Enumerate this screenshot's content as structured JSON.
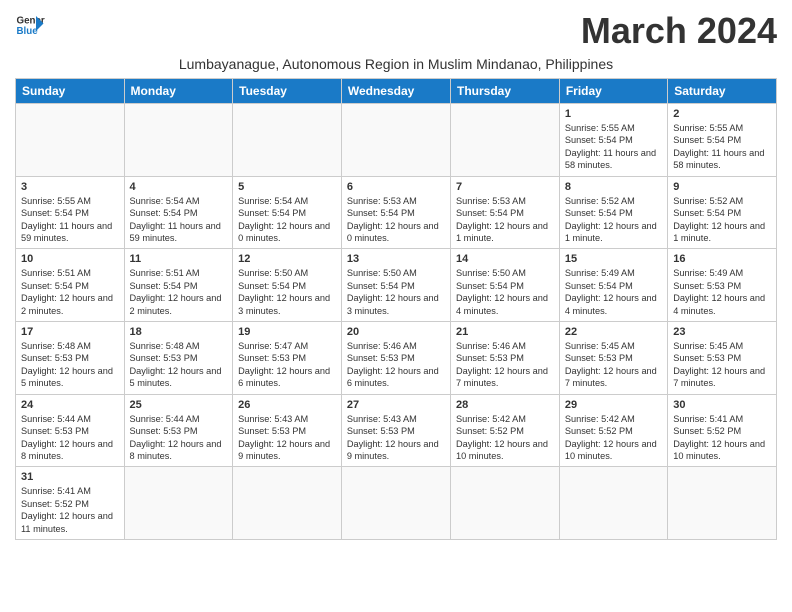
{
  "header": {
    "logo_line1": "General",
    "logo_line2": "Blue",
    "month_title": "March 2024",
    "location": "Lumbayanague, Autonomous Region in Muslim Mindanao, Philippines"
  },
  "weekdays": [
    "Sunday",
    "Monday",
    "Tuesday",
    "Wednesday",
    "Thursday",
    "Friday",
    "Saturday"
  ],
  "weeks": [
    [
      {
        "day": "",
        "text": ""
      },
      {
        "day": "",
        "text": ""
      },
      {
        "day": "",
        "text": ""
      },
      {
        "day": "",
        "text": ""
      },
      {
        "day": "",
        "text": ""
      },
      {
        "day": "1",
        "text": "Sunrise: 5:55 AM\nSunset: 5:54 PM\nDaylight: 11 hours and 58 minutes."
      },
      {
        "day": "2",
        "text": "Sunrise: 5:55 AM\nSunset: 5:54 PM\nDaylight: 11 hours and 58 minutes."
      }
    ],
    [
      {
        "day": "3",
        "text": "Sunrise: 5:55 AM\nSunset: 5:54 PM\nDaylight: 11 hours and 59 minutes."
      },
      {
        "day": "4",
        "text": "Sunrise: 5:54 AM\nSunset: 5:54 PM\nDaylight: 11 hours and 59 minutes."
      },
      {
        "day": "5",
        "text": "Sunrise: 5:54 AM\nSunset: 5:54 PM\nDaylight: 12 hours and 0 minutes."
      },
      {
        "day": "6",
        "text": "Sunrise: 5:53 AM\nSunset: 5:54 PM\nDaylight: 12 hours and 0 minutes."
      },
      {
        "day": "7",
        "text": "Sunrise: 5:53 AM\nSunset: 5:54 PM\nDaylight: 12 hours and 1 minute."
      },
      {
        "day": "8",
        "text": "Sunrise: 5:52 AM\nSunset: 5:54 PM\nDaylight: 12 hours and 1 minute."
      },
      {
        "day": "9",
        "text": "Sunrise: 5:52 AM\nSunset: 5:54 PM\nDaylight: 12 hours and 1 minute."
      }
    ],
    [
      {
        "day": "10",
        "text": "Sunrise: 5:51 AM\nSunset: 5:54 PM\nDaylight: 12 hours and 2 minutes."
      },
      {
        "day": "11",
        "text": "Sunrise: 5:51 AM\nSunset: 5:54 PM\nDaylight: 12 hours and 2 minutes."
      },
      {
        "day": "12",
        "text": "Sunrise: 5:50 AM\nSunset: 5:54 PM\nDaylight: 12 hours and 3 minutes."
      },
      {
        "day": "13",
        "text": "Sunrise: 5:50 AM\nSunset: 5:54 PM\nDaylight: 12 hours and 3 minutes."
      },
      {
        "day": "14",
        "text": "Sunrise: 5:50 AM\nSunset: 5:54 PM\nDaylight: 12 hours and 4 minutes."
      },
      {
        "day": "15",
        "text": "Sunrise: 5:49 AM\nSunset: 5:54 PM\nDaylight: 12 hours and 4 minutes."
      },
      {
        "day": "16",
        "text": "Sunrise: 5:49 AM\nSunset: 5:53 PM\nDaylight: 12 hours and 4 minutes."
      }
    ],
    [
      {
        "day": "17",
        "text": "Sunrise: 5:48 AM\nSunset: 5:53 PM\nDaylight: 12 hours and 5 minutes."
      },
      {
        "day": "18",
        "text": "Sunrise: 5:48 AM\nSunset: 5:53 PM\nDaylight: 12 hours and 5 minutes."
      },
      {
        "day": "19",
        "text": "Sunrise: 5:47 AM\nSunset: 5:53 PM\nDaylight: 12 hours and 6 minutes."
      },
      {
        "day": "20",
        "text": "Sunrise: 5:46 AM\nSunset: 5:53 PM\nDaylight: 12 hours and 6 minutes."
      },
      {
        "day": "21",
        "text": "Sunrise: 5:46 AM\nSunset: 5:53 PM\nDaylight: 12 hours and 7 minutes."
      },
      {
        "day": "22",
        "text": "Sunrise: 5:45 AM\nSunset: 5:53 PM\nDaylight: 12 hours and 7 minutes."
      },
      {
        "day": "23",
        "text": "Sunrise: 5:45 AM\nSunset: 5:53 PM\nDaylight: 12 hours and 7 minutes."
      }
    ],
    [
      {
        "day": "24",
        "text": "Sunrise: 5:44 AM\nSunset: 5:53 PM\nDaylight: 12 hours and 8 minutes."
      },
      {
        "day": "25",
        "text": "Sunrise: 5:44 AM\nSunset: 5:53 PM\nDaylight: 12 hours and 8 minutes."
      },
      {
        "day": "26",
        "text": "Sunrise: 5:43 AM\nSunset: 5:53 PM\nDaylight: 12 hours and 9 minutes."
      },
      {
        "day": "27",
        "text": "Sunrise: 5:43 AM\nSunset: 5:53 PM\nDaylight: 12 hours and 9 minutes."
      },
      {
        "day": "28",
        "text": "Sunrise: 5:42 AM\nSunset: 5:52 PM\nDaylight: 12 hours and 10 minutes."
      },
      {
        "day": "29",
        "text": "Sunrise: 5:42 AM\nSunset: 5:52 PM\nDaylight: 12 hours and 10 minutes."
      },
      {
        "day": "30",
        "text": "Sunrise: 5:41 AM\nSunset: 5:52 PM\nDaylight: 12 hours and 10 minutes."
      }
    ],
    [
      {
        "day": "31",
        "text": "Sunrise: 5:41 AM\nSunset: 5:52 PM\nDaylight: 12 hours and 11 minutes."
      },
      {
        "day": "",
        "text": ""
      },
      {
        "day": "",
        "text": ""
      },
      {
        "day": "",
        "text": ""
      },
      {
        "day": "",
        "text": ""
      },
      {
        "day": "",
        "text": ""
      },
      {
        "day": "",
        "text": ""
      }
    ]
  ]
}
